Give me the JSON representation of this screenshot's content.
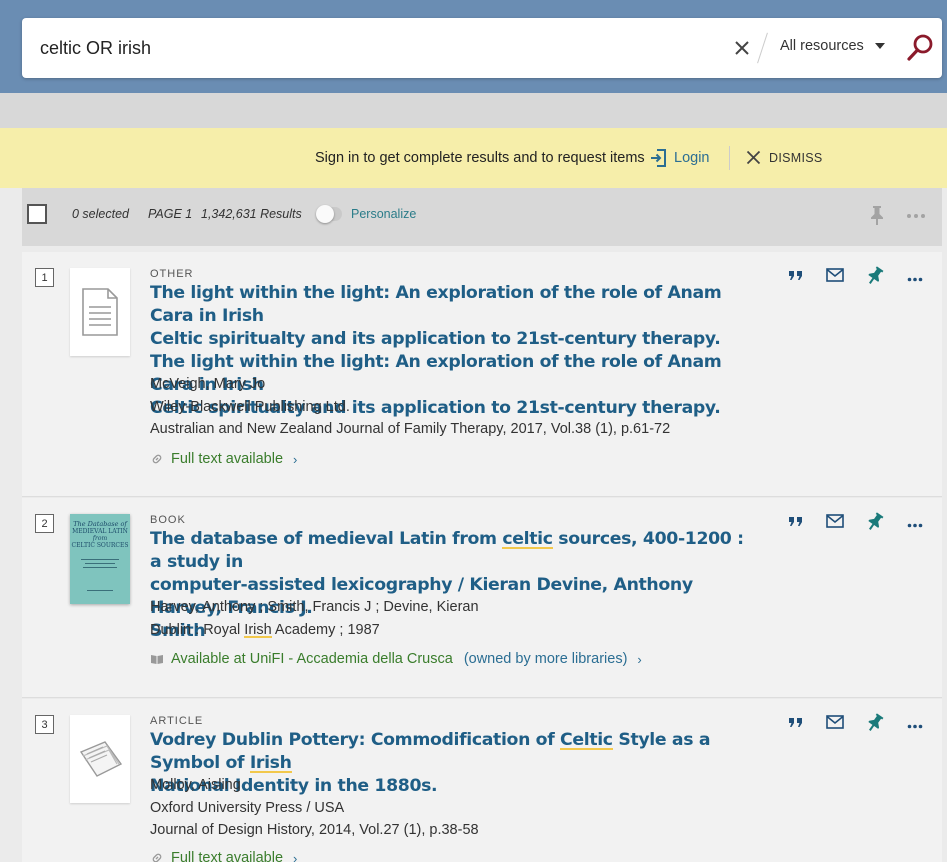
{
  "search": {
    "query": "celtic OR irish",
    "scope": "All resources"
  },
  "signin": {
    "message": "Sign in to get complete results and to request items",
    "login_label": "Login",
    "dismiss_label": "DISMISS"
  },
  "results_bar": {
    "selected": "0 selected",
    "page": "PAGE 1",
    "count": "1,342,631 Results",
    "personalize": "Personalize"
  },
  "results": [
    {
      "number": "1",
      "type": "OTHER",
      "title_line1": "The light within the light: An exploration of the role of Anam Cara in Irish",
      "title_line2": "Celtic spiritualty and its application to 21st-century therapy.",
      "title_line3": "The light within the light: An exploration of the role of Anam Cara in Irish",
      "title_line4": "Celtic spiritualty and its application to 21st-century therapy.",
      "author": "McVeigh, Mary Jo",
      "publisher": "Wiley-Blackwell Publishing Ltd.",
      "source": "Australian and New Zealand Journal of Family Therapy, 2017, Vol.38 (1), p.61-72",
      "availability": "Full text available"
    },
    {
      "number": "2",
      "type": "BOOK",
      "title_a": "The database of medieval Latin from ",
      "title_hl1": "celtic",
      "title_b": " sources, 400-1200 : a study in",
      "title_line2": "computer-assisted lexicography / Kieran Devine, Anthony Harvey, Francis J.",
      "title_line3": "Smith",
      "authors": "Harvey, Anthony ; Smith, Francis J ; Devine, Kieran",
      "pub_a": "Dublin : Royal ",
      "pub_hl": "Irish",
      "pub_b": " Academy ; 1987",
      "availability": "Available at UniFI - Accademia della Crusca",
      "owned": "(owned by more libraries)",
      "cover_line1": "The Database of",
      "cover_line2": "MEDIEVAL LATIN",
      "cover_line3": "from",
      "cover_line4": "CELTIC SOURCES"
    },
    {
      "number": "3",
      "type": "ARTICLE",
      "title_a": "Vodrey Dublin Pottery: Commodification of ",
      "title_hl1": "Celtic",
      "title_b": " Style as a Symbol of ",
      "title_hl2": "Irish",
      "title_line2": "National Identity in the 1880s.",
      "author": "Molloy, Aisling",
      "publisher": "Oxford University Press / USA",
      "source": "Journal of Design History, 2014, Vol.27 (1), p.38-58",
      "availability": "Full text available"
    }
  ],
  "colors": {
    "header": "#6a8db3",
    "signin_banner": "#f6eeaa",
    "title_link": "#1f5e86",
    "available": "#3a7d2c",
    "search_icon": "#8b1a2b",
    "highlight": "#f2c84b"
  }
}
